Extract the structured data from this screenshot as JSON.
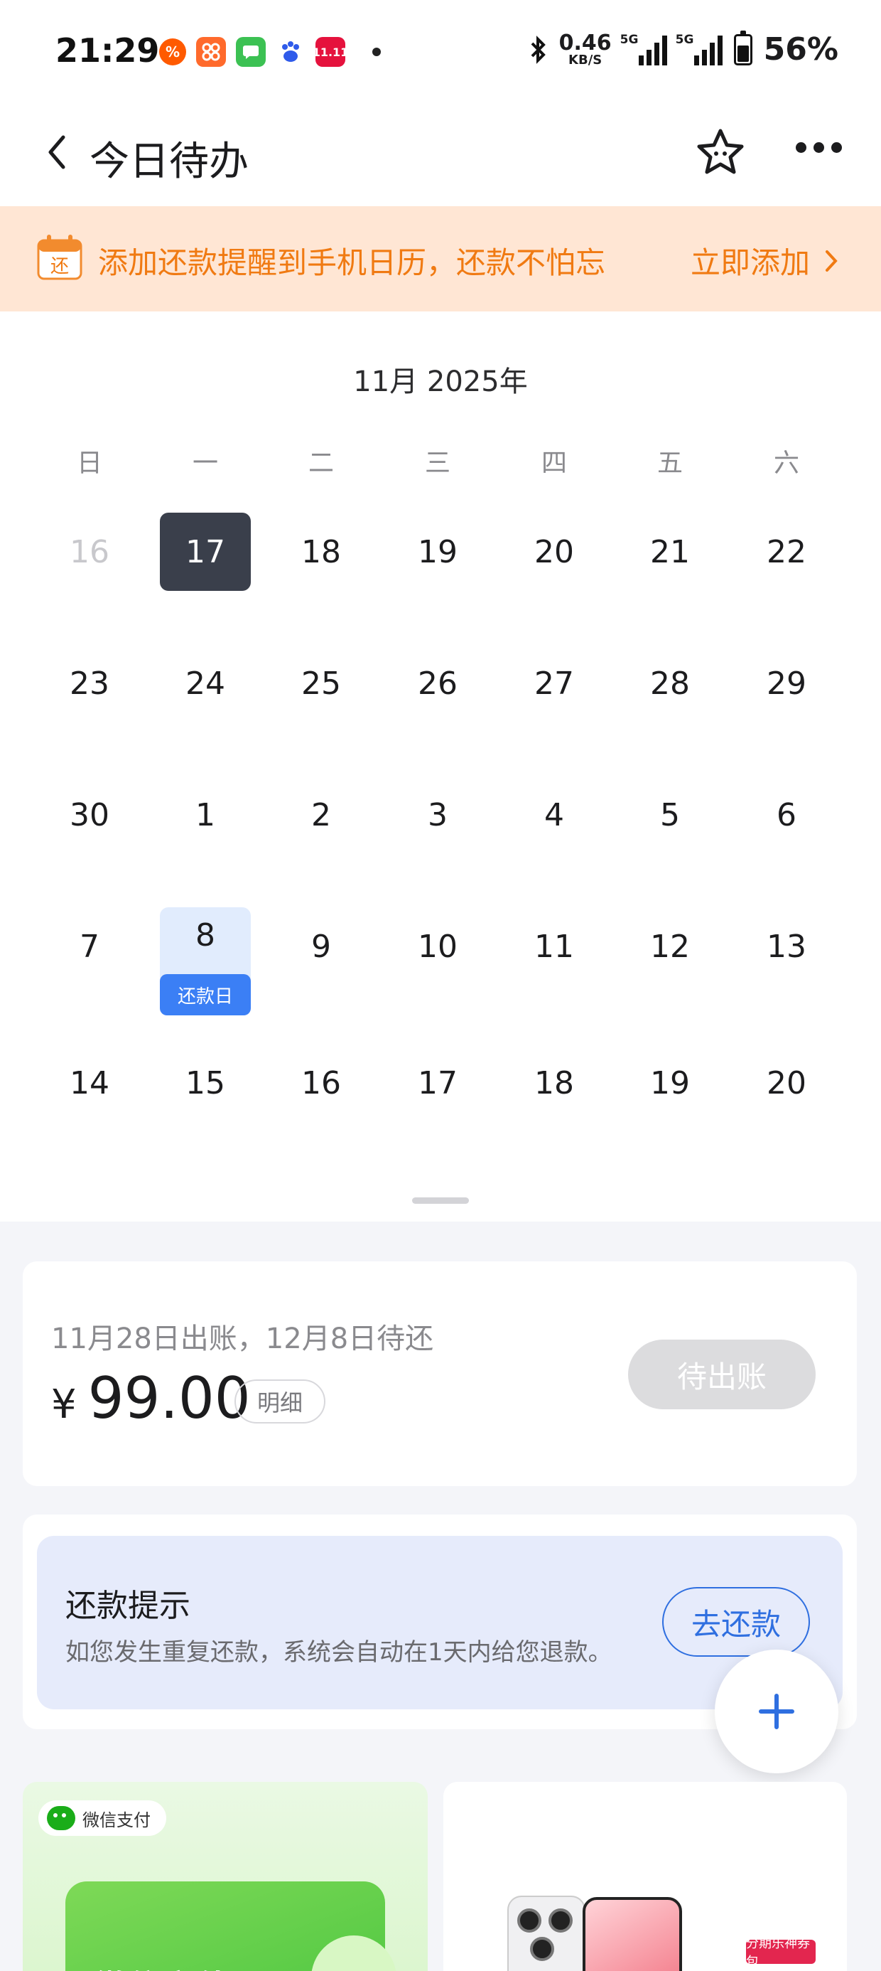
{
  "status_bar": {
    "time": "21:29",
    "net_speed_value": "0.46",
    "net_speed_unit": "KB/S",
    "signal1_label": "5G",
    "signal2_label": "5G",
    "battery_text": "56%",
    "app_icons": [
      "taobao-icon",
      "app-grid-icon",
      "messages-icon",
      "baidu-icon",
      "tmall-1111-icon"
    ],
    "app_icon_1111_text": "11.11"
  },
  "nav": {
    "title": "今日待办"
  },
  "banner": {
    "icon_text": "还",
    "text": "添加还款提醒到手机日历，还款不怕忘",
    "action": "立即添加"
  },
  "calendar": {
    "month_label": "11月 2025年",
    "weekdays": [
      "日",
      "一",
      "二",
      "三",
      "四",
      "五",
      "六"
    ],
    "weeks": [
      [
        "16",
        "17",
        "18",
        "19",
        "20",
        "21",
        "22"
      ],
      [
        "23",
        "24",
        "25",
        "26",
        "27",
        "28",
        "29"
      ],
      [
        "30",
        "1",
        "2",
        "3",
        "4",
        "5",
        "6"
      ],
      [
        "7",
        "8",
        "9",
        "10",
        "11",
        "12",
        "13"
      ],
      [
        "14",
        "15",
        "16",
        "17",
        "18",
        "19",
        "20"
      ]
    ],
    "due_tag": "还款日"
  },
  "bill": {
    "subtitle": "11月28日出账，12月8日待还",
    "currency": "¥",
    "amount": "99.00",
    "detail_label": "明细",
    "status_button": "待出账"
  },
  "tip": {
    "title": "还款提示",
    "desc": "如您发生重复还款，系统会自动在1天内给您退款。",
    "button": "去还款"
  },
  "promo": {
    "wechat_badge": "微信支付",
    "left_text": "微信充值",
    "right_tag": "分期乐神券包"
  },
  "colors": {
    "accent_blue": "#3b7ff5",
    "banner_orange": "#f07a12",
    "banner_bg": "#ffe6d4",
    "today_bg": "#3a3f4b"
  }
}
